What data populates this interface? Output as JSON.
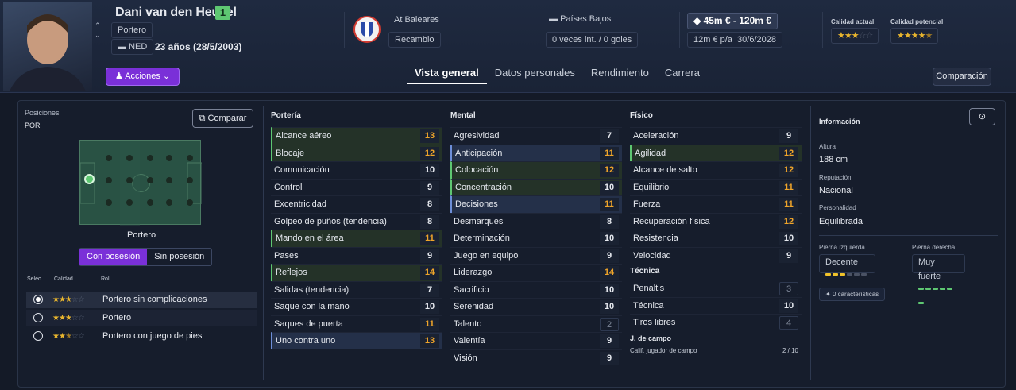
{
  "player": {
    "name": "Dani van den Heuvel",
    "number": "1",
    "position": "Portero",
    "nationality_code": "NED",
    "age": "23 años (28/5/2003)"
  },
  "club": {
    "name": "At Baleares",
    "status": "Recambio"
  },
  "nation": {
    "name": "Países Bajos",
    "caps": "0 veces int. / 0 goles"
  },
  "value": {
    "range": "45m € - 120m €",
    "wage": "12m € p/a",
    "contract_end": "30/6/2028"
  },
  "ability": {
    "current_label": "Calidad actual",
    "potential_label": "Calidad potencial",
    "current_stars": 3,
    "potential_stars": 4.5
  },
  "actions_label": "Acciones",
  "tabs": [
    "Vista general",
    "Datos personales",
    "Rendimiento",
    "Carrera"
  ],
  "comparison_label": "Comparación",
  "positions": {
    "label": "Posiciones",
    "value": "POR",
    "compare_label": "Comparar",
    "pitch_caption": "Portero"
  },
  "segment": {
    "with": "Con posesión",
    "without": "Sin posesión"
  },
  "roles_header": {
    "select": "Selec...",
    "quality": "Calidad",
    "role": "Rol"
  },
  "roles": [
    {
      "name": "Portero sin complicaciones",
      "stars": 3,
      "selected": true
    },
    {
      "name": "Portero",
      "stars": 3,
      "selected": false
    },
    {
      "name": "Portero con juego de pies",
      "stars": 2.5,
      "selected": false
    }
  ],
  "attributes": {
    "porteria": {
      "title": "Portería",
      "items": [
        {
          "n": "Alcance aéreo",
          "v": "13",
          "s": "o",
          "h": "hl"
        },
        {
          "n": "Blocaje",
          "v": "12",
          "s": "o",
          "h": "hl"
        },
        {
          "n": "Comunicación",
          "v": "10",
          "s": "",
          "h": ""
        },
        {
          "n": "Control",
          "v": "9",
          "s": "",
          "h": ""
        },
        {
          "n": "Excentricidad",
          "v": "8",
          "s": "",
          "h": ""
        },
        {
          "n": "Golpeo de puños (tendencia)",
          "v": "8",
          "s": "",
          "h": ""
        },
        {
          "n": "Mando en el área",
          "v": "11",
          "s": "o",
          "h": "hl"
        },
        {
          "n": "Pases",
          "v": "9",
          "s": "",
          "h": ""
        },
        {
          "n": "Reflejos",
          "v": "14",
          "s": "o",
          "h": "hl"
        },
        {
          "n": "Salidas (tendencia)",
          "v": "7",
          "s": "",
          "h": ""
        },
        {
          "n": "Saque con la mano",
          "v": "10",
          "s": "",
          "h": ""
        },
        {
          "n": "Saques de puerta",
          "v": "11",
          "s": "o",
          "h": ""
        },
        {
          "n": "Uno contra uno",
          "v": "13",
          "s": "o",
          "h": "hb"
        }
      ]
    },
    "mental": {
      "title": "Mental",
      "items": [
        {
          "n": "Agresividad",
          "v": "7",
          "s": "",
          "h": ""
        },
        {
          "n": "Anticipación",
          "v": "11",
          "s": "o",
          "h": "hb"
        },
        {
          "n": "Colocación",
          "v": "12",
          "s": "o",
          "h": "hl"
        },
        {
          "n": "Concentración",
          "v": "10",
          "s": "",
          "h": "hl"
        },
        {
          "n": "Decisiones",
          "v": "11",
          "s": "o",
          "h": "hb"
        },
        {
          "n": "Desmarques",
          "v": "8",
          "s": "",
          "h": ""
        },
        {
          "n": "Determinación",
          "v": "10",
          "s": "",
          "h": ""
        },
        {
          "n": "Juego en equipo",
          "v": "9",
          "s": "",
          "h": ""
        },
        {
          "n": "Liderazgo",
          "v": "14",
          "s": "o",
          "h": ""
        },
        {
          "n": "Sacrificio",
          "v": "10",
          "s": "",
          "h": ""
        },
        {
          "n": "Serenidad",
          "v": "10",
          "s": "",
          "h": ""
        },
        {
          "n": "Talento",
          "v": "2",
          "s": "g",
          "h": ""
        },
        {
          "n": "Valentía",
          "v": "9",
          "s": "",
          "h": ""
        },
        {
          "n": "Visión",
          "v": "9",
          "s": "",
          "h": ""
        }
      ]
    },
    "fisico": {
      "title": "Físico",
      "items": [
        {
          "n": "Aceleración",
          "v": "9",
          "s": "",
          "h": ""
        },
        {
          "n": "Agilidad",
          "v": "12",
          "s": "o",
          "h": "hl"
        },
        {
          "n": "Alcance de salto",
          "v": "12",
          "s": "o",
          "h": ""
        },
        {
          "n": "Equilibrio",
          "v": "11",
          "s": "o",
          "h": ""
        },
        {
          "n": "Fuerza",
          "v": "11",
          "s": "o",
          "h": ""
        },
        {
          "n": "Recuperación física",
          "v": "12",
          "s": "o",
          "h": ""
        },
        {
          "n": "Resistencia",
          "v": "10",
          "s": "",
          "h": ""
        },
        {
          "n": "Velocidad",
          "v": "9",
          "s": "",
          "h": ""
        }
      ]
    },
    "tecnica": {
      "title": "Técnica",
      "items": [
        {
          "n": "Penaltis",
          "v": "3",
          "s": "g",
          "h": ""
        },
        {
          "n": "Técnica",
          "v": "10",
          "s": "",
          "h": ""
        },
        {
          "n": "Tiros libres",
          "v": "4",
          "s": "g",
          "h": ""
        }
      ]
    },
    "campo": {
      "title": "J. de campo",
      "label": "Calif. jugador de campo",
      "value": "2 / 10"
    }
  },
  "info": {
    "title": "Información",
    "height_label": "Altura",
    "height": "188 cm",
    "rep_label": "Reputación",
    "rep": "Nacional",
    "pers_label": "Personalidad",
    "pers": "Equilibrada",
    "left_label": "Pierna izquierda",
    "left": "Decente",
    "right_label": "Pierna derecha",
    "right": "Muy fuerte",
    "traits": "0 características",
    "left_level": 3,
    "right_level": 6
  },
  "colors": {
    "accent": "#7a30d8",
    "good": "#5ec772",
    "high": "#f0a52a",
    "star": "#e8b52e"
  }
}
